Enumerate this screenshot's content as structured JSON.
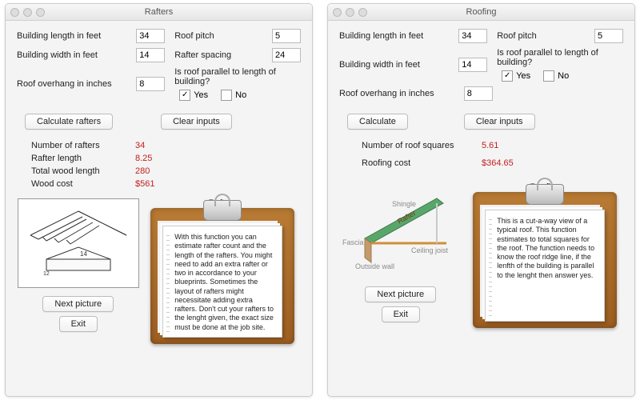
{
  "windows": [
    {
      "title": "Rafters",
      "inputs": {
        "building_length_label": "Building length in feet",
        "building_length_value": "34",
        "building_width_label": "Building width in feet",
        "building_width_value": "14",
        "overhang_label": "Roof overhang in inches",
        "overhang_value": "8",
        "pitch_label": "Roof pitch",
        "pitch_value": "5",
        "spacing_label": "Rafter spacing",
        "spacing_value": "24",
        "parallel_question": "Is roof parallel to length of building?",
        "yes_label": "Yes",
        "no_label": "No",
        "yes_checked": true,
        "no_checked": false
      },
      "buttons": {
        "calculate": "Calculate rafters",
        "clear": "Clear inputs",
        "next": "Next picture",
        "exit": "Exit"
      },
      "results": [
        {
          "label": "Number of rafters",
          "value": "34"
        },
        {
          "label": "Rafter length",
          "value": "8.25"
        },
        {
          "label": "Total wood length",
          "value": "280"
        },
        {
          "label": "Wood cost",
          "value": "$561"
        }
      ],
      "clipboard_title": "Rafters",
      "clipboard_text": "With this function you can estimate rafter count and the length of the rafters. You might need to add an extra rafter or two in accordance to your blueprints. Sometimes the layout of rafters might necessitate adding extra rafters. Don't cut your rafters to the lenght given, the exact size must be done at the job site.",
      "diagram_labels": {
        "dim1": "14",
        "dim2": "12"
      }
    },
    {
      "title": "Roofing",
      "inputs": {
        "building_length_label": "Building length in feet",
        "building_length_value": "34",
        "building_width_label": "Building width in feet",
        "building_width_value": "14",
        "overhang_label": "Roof overhang in inches",
        "overhang_value": "8",
        "pitch_label": "Roof pitch",
        "pitch_value": "5",
        "parallel_question": "Is roof parallel to length of building?",
        "yes_label": "Yes",
        "no_label": "No",
        "yes_checked": true,
        "no_checked": false
      },
      "buttons": {
        "calculate": "Calculate",
        "clear": "Clear inputs",
        "next": "Next picture",
        "exit": "Exit"
      },
      "results": [
        {
          "label": "Number of roof squares",
          "value": "5.61"
        },
        {
          "label": "Roofing cost",
          "value": "$364.65"
        }
      ],
      "clipboard_title": "Roofing",
      "clipboard_text": "This is a cut-a-way view of a typical roof. This function estimates to total squares for the roof. The function needs to know the roof ridge line, if the lenfth of the building is parallel to the lenght then answer yes.",
      "diagram_labels": {
        "shingle": "Shingle",
        "rafter": "Rafter",
        "ceiling_joist": "Ceiling joist",
        "fascia": "Fascia",
        "outside_wall": "Outside wall"
      }
    }
  ]
}
